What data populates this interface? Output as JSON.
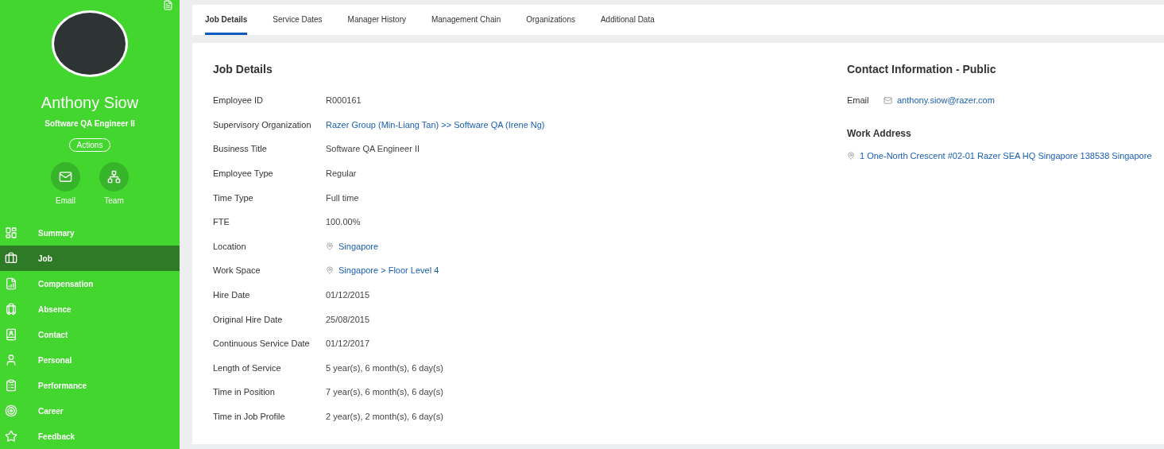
{
  "profile": {
    "name": "Anthony Siow",
    "title": "Software QA Engineer II",
    "actions_label": "Actions",
    "quick_actions": [
      "Email",
      "Team"
    ]
  },
  "nav": [
    {
      "label": "Summary",
      "selected": false
    },
    {
      "label": "Job",
      "selected": true
    },
    {
      "label": "Compensation",
      "selected": false
    },
    {
      "label": "Absence",
      "selected": false
    },
    {
      "label": "Contact",
      "selected": false
    },
    {
      "label": "Personal",
      "selected": false
    },
    {
      "label": "Performance",
      "selected": false
    },
    {
      "label": "Career",
      "selected": false
    },
    {
      "label": "Feedback",
      "selected": false
    }
  ],
  "tabs": [
    {
      "label": "Job Details",
      "selected": true
    },
    {
      "label": "Service Dates",
      "selected": false
    },
    {
      "label": "Manager History",
      "selected": false
    },
    {
      "label": "Management Chain",
      "selected": false
    },
    {
      "label": "Organizations",
      "selected": false
    },
    {
      "label": "Additional Data",
      "selected": false
    }
  ],
  "job_details": {
    "title": "Job Details",
    "fields": [
      {
        "label": "Employee ID",
        "value": "R000161",
        "kind": "text"
      },
      {
        "label": "Supervisory Organization",
        "value": "Razer Group (Min-Liang Tan) >> Software QA (Irene Ng)",
        "kind": "link"
      },
      {
        "label": "Business Title",
        "value": "Software QA Engineer II",
        "kind": "text"
      },
      {
        "label": "Employee Type",
        "value": "Regular",
        "kind": "text"
      },
      {
        "label": "Time Type",
        "value": "Full time",
        "kind": "text"
      },
      {
        "label": "FTE",
        "value": "100.00%",
        "kind": "text"
      },
      {
        "label": "Location",
        "value": "Singapore",
        "kind": "location"
      },
      {
        "label": "Work Space",
        "value": "Singapore > Floor Level 4",
        "kind": "location"
      },
      {
        "label": "Hire Date",
        "value": "01/12/2015",
        "kind": "text"
      },
      {
        "label": "Original Hire Date",
        "value": "25/08/2015",
        "kind": "text"
      },
      {
        "label": "Continuous Service Date",
        "value": "01/12/2017",
        "kind": "text"
      },
      {
        "label": "Length of Service",
        "value": "5 year(s), 6 month(s), 6 day(s)",
        "kind": "text"
      },
      {
        "label": "Time in Position",
        "value": "7 year(s), 6 month(s), 6 day(s)",
        "kind": "text"
      },
      {
        "label": "Time in Job Profile",
        "value": "2 year(s), 2 month(s), 6 day(s)",
        "kind": "text"
      }
    ]
  },
  "contact": {
    "title": "Contact Information - Public",
    "email_label": "Email",
    "email": "anthony.siow@razer.com",
    "address_title": "Work Address",
    "address": "1 One-North Crescent #02-01 Razer SEA HQ Singapore 138538 Singapore"
  }
}
